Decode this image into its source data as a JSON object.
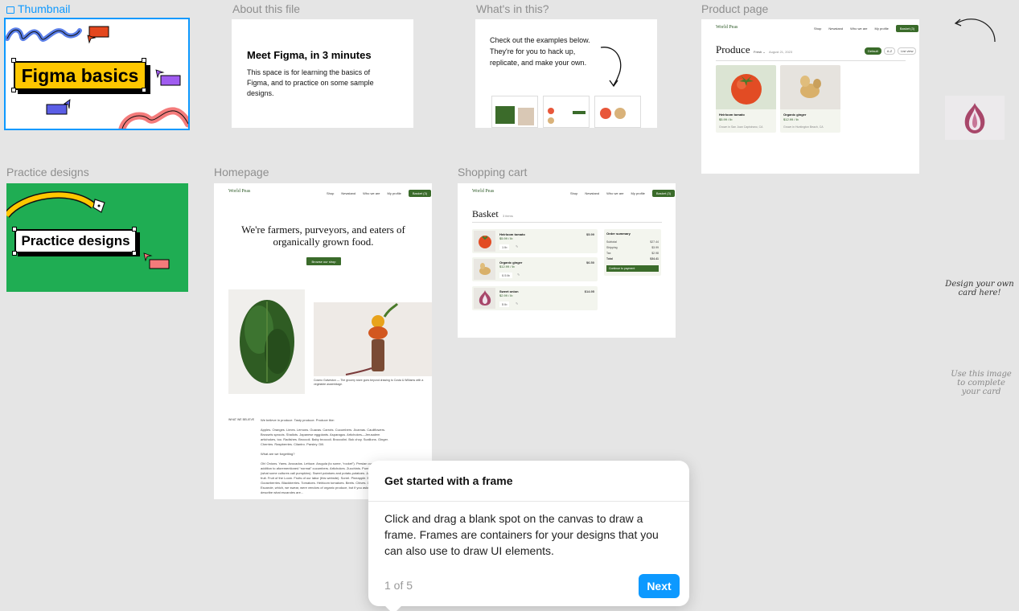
{
  "frames": {
    "thumbnail": {
      "label": "Thumbnail",
      "title": "Figma basics"
    },
    "about": {
      "label": "About this file",
      "title": "Meet Figma, in 3 minutes",
      "body": "This space is for learning the basics of Figma, and to practice on some sample designs."
    },
    "whats": {
      "label": "What's in this?",
      "body": "Check out the examples below. They're for you to hack up, replicate, and make your own."
    },
    "product": {
      "label": "Product page",
      "logo": "World Peas",
      "nav": [
        "Shop",
        "Newstand",
        "Who we are",
        "My profile"
      ],
      "cta": "Basket (3)",
      "title": "Produce",
      "filter": "Fresh",
      "date": "August 21, 2023",
      "chips": [
        "Default",
        "A-Z",
        "List view"
      ],
      "cards": [
        {
          "name": "Heirloom tomato",
          "price": "$5.99 / lb",
          "origin": "Grown in San Juan Capistrano, CA"
        },
        {
          "name": "Organic ginger",
          "price": "$12.99 / lb",
          "origin": "Grown in Huntington Beach, CA"
        }
      ]
    },
    "practice": {
      "label": "Practice designs",
      "title": "Practice designs"
    },
    "homepage": {
      "label": "Homepage",
      "logo": "World Peas",
      "nav": [
        "Shop",
        "Newstand",
        "Who we are",
        "My profile"
      ],
      "cta": "Basket (3)",
      "hero": "We're farmers, purveyors, and eaters of organically grown food.",
      "button": "Browse our shop",
      "caption": "Cosmo Galveston — The grocery store goes beyond drawing to Costa & Williams with a vegetable assemblage.",
      "section_label": "WHAT WE BELIEVE",
      "p1": "We believe in produce. Tasty produce. Produce like:",
      "p2": "Apples. Oranges. Limes. Lemons. Guavas. Carrots. Cucumbers. Jicamas. Cauliflowers. Brussels sprouts. Shallots. Japanese eggplants. Asparagus. Artichokes—Jerusalem artichokes, too. Radishes. Broccoli. Baby broccoli. Broccolini. Bok choy. Scallions. Ginger. Cherries. Raspberries. Cilantro. Parsley. Dill.",
      "p3": "What are we forgetting?",
      "p4": "Oh! Onions. Yams. Avocados. Lettuce. Arugula (to some, “rocket”). Persian cucumbers, in addition to aforementioned “normal” cucumbers. Artichokes. Zucchinis. Pumpkins. Squash (what some cultures call pumpkins). Sweet potatoes and potato-potatoes. Jackfruit. Monk fruit. Fruit of the Loom. Fruits of our labor (this website). Sorrel. Pineapple. Mango. Gooseberries. Blackberries. Tomatoes. Heirloom tomatoes. Beets. Chives. Corn. Endive. Escarole, which, we swear, were vendors of organic produce, but if you asked us to describe what escaroles are..."
    },
    "cart": {
      "label": "Shopping cart",
      "logo": "World Peas",
      "nav": [
        "Shop",
        "Newstand",
        "Who we are",
        "My profile"
      ],
      "cta": "Basket (3)",
      "title": "Basket",
      "count": "3 items",
      "items": [
        {
          "name": "Heirloom tomato",
          "price": "$5.99 / lb",
          "total": "$5.99",
          "qty": "1 lb"
        },
        {
          "name": "Organic ginger",
          "price": "$12.99 / lb",
          "total": "$6.50",
          "qty": "0.5 lb"
        },
        {
          "name": "Sweet onion",
          "price": "$2.99 / lb",
          "total": "$14.95",
          "qty": "5 lb"
        }
      ],
      "summary": {
        "title": "Order summary",
        "rows": [
          {
            "k": "Subtotal",
            "v": "$27.44"
          },
          {
            "k": "Shipping",
            "v": "$3.99"
          },
          {
            "k": "Tax",
            "v": "$2.98"
          },
          {
            "k": "Total",
            "v": "$34.41"
          }
        ],
        "button": "Continue to payment"
      }
    }
  },
  "notes": {
    "design": "Design your own card here!",
    "use_image": "Use this image to complete your card"
  },
  "onboarding": {
    "title": "Get started with a frame",
    "body": "Click and drag a blank spot on the canvas to draw a frame. Frames are containers for your designs that you can also use to draw UI elements.",
    "step": "1 of 5",
    "next": "Next"
  },
  "colors": {
    "selection": "#0d99ff",
    "brand_green": "#3a6b2a",
    "practice_bg": "#1fad53",
    "highlight_yellow": "#ffc700"
  }
}
